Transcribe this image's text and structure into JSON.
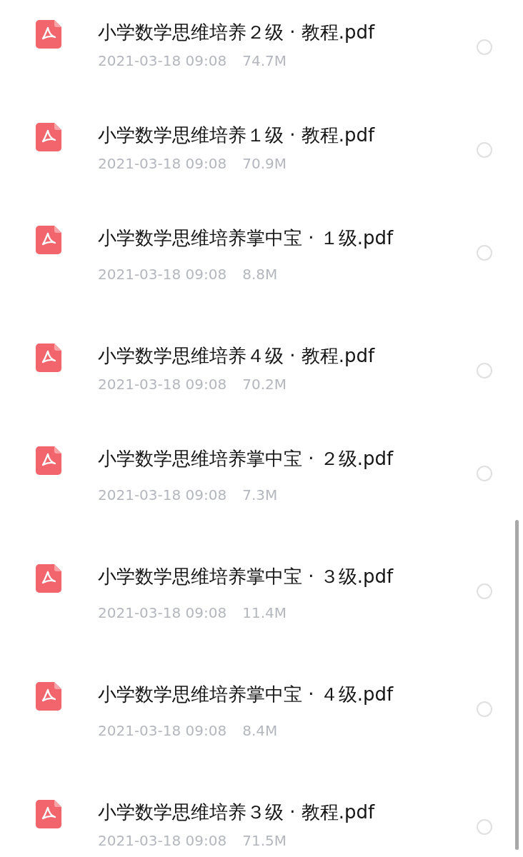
{
  "files": [
    {
      "kind": "tutorial",
      "name": "小学数学思维培养２级 · 教程.pdf",
      "date": "2021-03-18 09:08",
      "size": "74.7M",
      "selected": false
    },
    {
      "kind": "tutorial",
      "name": "小学数学思维培养１级 · 教程.pdf",
      "date": "2021-03-18 09:08",
      "size": "70.9M",
      "selected": false
    },
    {
      "kind": "handbook",
      "name": "小学数学思维培养掌中宝 · １级.pdf",
      "date": "2021-03-18 09:08",
      "size": "8.8M",
      "selected": false
    },
    {
      "kind": "tutorial",
      "name": "小学数学思维培养４级 · 教程.pdf",
      "date": "2021-03-18 09:08",
      "size": "70.2M",
      "selected": false
    },
    {
      "kind": "handbook",
      "name": "小学数学思维培养掌中宝 · ２级.pdf",
      "date": "2021-03-18 09:08",
      "size": "7.3M",
      "selected": false
    },
    {
      "kind": "handbook",
      "name": "小学数学思维培养掌中宝 · ３级.pdf",
      "date": "2021-03-18 09:08",
      "size": "11.4M",
      "selected": false
    },
    {
      "kind": "handbook",
      "name": "小学数学思维培养掌中宝 · ４级.pdf",
      "date": "2021-03-18 09:08",
      "size": "8.4M",
      "selected": false
    },
    {
      "kind": "tutorial",
      "name": "小学数学思维培养３级 · 教程.pdf",
      "date": "2021-03-18 09:08",
      "size": "71.5M",
      "selected": false
    }
  ]
}
